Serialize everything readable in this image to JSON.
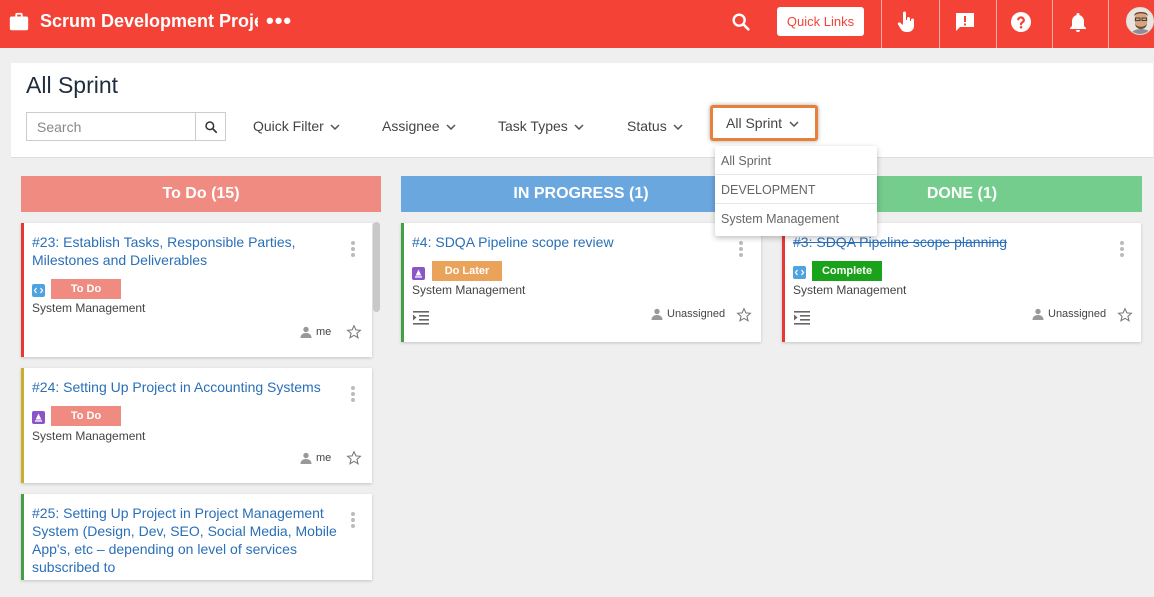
{
  "topbar": {
    "project_title": "Scrum Development Project",
    "more_label": "•••",
    "quick_links_label": "Quick Links"
  },
  "header": {
    "page_title": "All Sprint",
    "search_placeholder": "Search",
    "filters": {
      "quick_filter": "Quick Filter",
      "assignee": "Assignee",
      "task_types": "Task Types",
      "status": "Status",
      "sprint": "All Sprint"
    }
  },
  "sprint_dropdown": {
    "options": [
      "All Sprint",
      "DEVELOPMENT",
      "System Management"
    ]
  },
  "columns": {
    "todo": {
      "title": "To Do (15)",
      "cards": [
        {
          "title": "#23: Establish Tasks, Responsible Parties, Milestones and Deliverables",
          "status": "To Do",
          "subtitle": "System Management",
          "assignee": "me",
          "type_icon": "code-icon",
          "accent": "#e53935"
        },
        {
          "title": "#24: Setting Up Project in Accounting Systems",
          "status": "To Do",
          "subtitle": "System Management",
          "assignee": "me",
          "type_icon": "task-icon",
          "accent": "#c8b02c"
        },
        {
          "title": "#25: Setting Up Project in Project Management System (Design, Dev, SEO, Social Media, Mobile App's, etc – depending on level of services subscribed to",
          "accent": "#43a047"
        }
      ]
    },
    "in_progress": {
      "title": "IN PROGRESS (1)",
      "cards": [
        {
          "title": "#4: SDQA Pipeline scope review",
          "status": "Do Later",
          "subtitle": "System Management",
          "assignee": "Unassigned",
          "type_icon": "task-icon",
          "accent": "#43a047"
        }
      ]
    },
    "done": {
      "title": "DONE (1)",
      "cards": [
        {
          "title": "#3: SDQA Pipeline scope planning",
          "status": "Complete",
          "subtitle": "System Management",
          "assignee": "Unassigned",
          "type_icon": "code-icon",
          "accent": "#e53935"
        }
      ]
    }
  },
  "colors": {
    "topbar": "#f44336",
    "todo_header": "#f08b81",
    "progress_header": "#6ba7df",
    "done_header": "#74cc8d",
    "todo_badge": "#f08b81",
    "do_later_badge": "#e9a35a",
    "complete_badge": "#1aa31a",
    "highlight": "#e8803a"
  }
}
